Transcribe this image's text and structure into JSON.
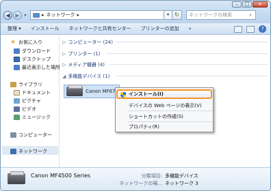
{
  "window": {
    "minimize": "–",
    "maximize": "□",
    "close": "x"
  },
  "address": {
    "back": "◀",
    "forward": "▶",
    "crumb_sep": "▸",
    "path": "ネットワーク",
    "path_arrow": "▸",
    "refresh": "↻",
    "search_placeholder": "ネットワークの検索",
    "search_icon": "⌕"
  },
  "toolbar": {
    "items": [
      "整理 ▾",
      "インストール",
      "ネットワークと共有センター",
      "プリンターの追加",
      "»"
    ]
  },
  "sidebar": {
    "items": [
      {
        "label": "お気に入り"
      },
      {
        "label": "ダウンロード"
      },
      {
        "label": "デスクトップ"
      },
      {
        "label": "最近表示した場所"
      },
      {
        "label": "ライブラリ"
      },
      {
        "label": "ドキュメント"
      },
      {
        "label": "ピクチャ"
      },
      {
        "label": "ビデオ"
      },
      {
        "label": "ミュージック"
      },
      {
        "label": "コンピューター"
      },
      {
        "label": "ネットワーク"
      }
    ]
  },
  "main": {
    "groups": [
      {
        "label": "コンピューター (24)"
      },
      {
        "label": "プリンター (1)"
      },
      {
        "label": "メディア機器 (4)"
      },
      {
        "label": "多機能デバイス (1)"
      }
    ],
    "device": {
      "name": "Canon MF670"
    }
  },
  "context_menu": {
    "items": [
      {
        "label": "インストール(I)"
      },
      {
        "label": "デバイスの Web ページの表示(V)"
      },
      {
        "label": "ショートカットの作成(S)"
      },
      {
        "label": "プロパティ(R)"
      }
    ]
  },
  "details": {
    "name": "Canon MF4500 Series",
    "category_label": "分類項目:",
    "category_value": "多機能デバイス",
    "location_label": "ネットワークの場...",
    "location_value": "ネットワーク 3"
  }
}
